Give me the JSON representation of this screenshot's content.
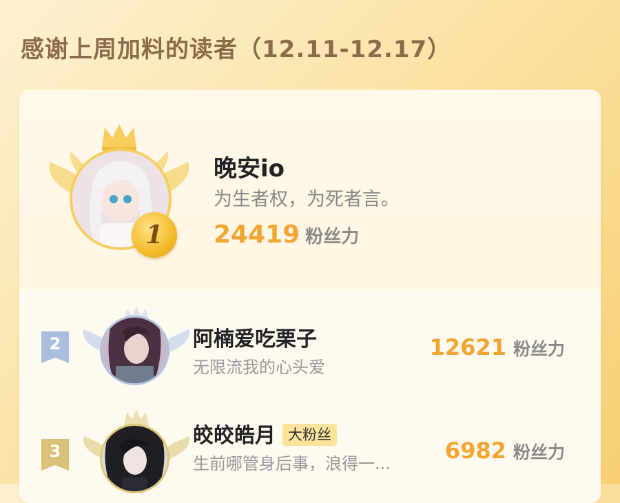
{
  "page": {
    "title": "感谢上周加料的读者（12.11-12.17）"
  },
  "ranking": [
    {
      "rank": "1",
      "name": "晚安io",
      "motto": "为生者权，为死者言。",
      "score": "24419",
      "unit": "粉丝力"
    },
    {
      "rank": "2",
      "name": "阿楠爱吃栗子",
      "motto": "无限流我的心头爱",
      "score": "12621",
      "unit": "粉丝力"
    },
    {
      "rank": "3",
      "name": "皎皎皓月",
      "badge": "大粉丝",
      "motto": "生前哪管身后事，浪得一...",
      "score": "6982",
      "unit": "粉丝力"
    }
  ],
  "colors": {
    "score": "#f2a531",
    "gold": "#f7cd5e",
    "silver": "#a9bedc",
    "bronze": "#d9c179"
  }
}
